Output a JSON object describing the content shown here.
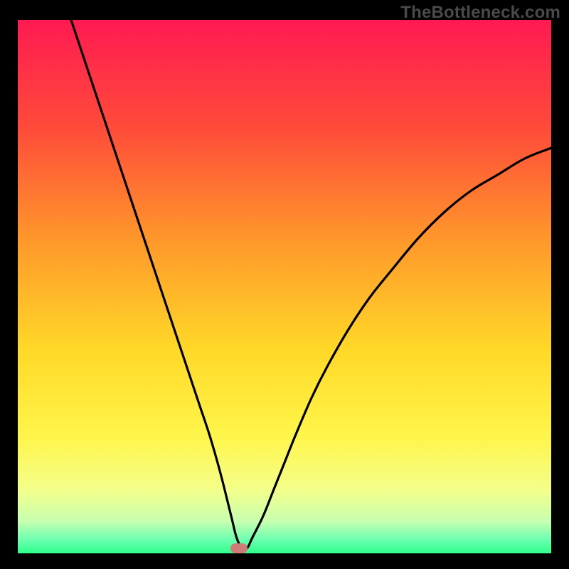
{
  "watermark": "TheBottleneck.com",
  "colors": {
    "top": "#ff1a52",
    "mid_upper": "#ff8a2a",
    "mid": "#ffe828",
    "mid_lower": "#f6ff7a",
    "green": "#2eff8a",
    "curve": "#000000",
    "marker": "#cf7b77",
    "border": "#000000"
  },
  "chart_data": {
    "type": "line",
    "title": "",
    "xlabel": "",
    "ylabel": "",
    "xlim": [
      0,
      100
    ],
    "ylim": [
      0,
      100
    ],
    "annotations": [
      {
        "type": "marker",
        "x": 41.5,
        "y": 1,
        "shape": "rounded-rect",
        "color": "#cf7b77"
      }
    ],
    "series": [
      {
        "name": "bottleneck-curve",
        "x": [
          10,
          12,
          14,
          16,
          18,
          20,
          22,
          24,
          26,
          28,
          30,
          32,
          34,
          36,
          38,
          40,
          41,
          42,
          43,
          44,
          46,
          48,
          50,
          52,
          55,
          58,
          62,
          66,
          70,
          75,
          80,
          85,
          90,
          95,
          100
        ],
        "y": [
          100,
          94,
          88,
          82,
          76,
          70,
          64,
          58,
          52,
          46,
          40,
          34,
          28,
          22,
          15,
          7,
          3,
          1,
          1,
          3,
          7,
          12,
          17,
          22,
          29,
          35,
          42,
          48,
          53,
          59,
          64,
          68,
          71,
          74,
          76
        ]
      }
    ],
    "background_gradient_stops": [
      {
        "offset": 0.0,
        "color": "#ff1a52"
      },
      {
        "offset": 0.2,
        "color": "#ff4a3a"
      },
      {
        "offset": 0.42,
        "color": "#ff9a2a"
      },
      {
        "offset": 0.62,
        "color": "#ffd928"
      },
      {
        "offset": 0.78,
        "color": "#fff54a"
      },
      {
        "offset": 0.88,
        "color": "#f4ff8a"
      },
      {
        "offset": 0.94,
        "color": "#c8ffb0"
      },
      {
        "offset": 0.975,
        "color": "#6affb0"
      },
      {
        "offset": 1.0,
        "color": "#2eff8a"
      }
    ]
  }
}
